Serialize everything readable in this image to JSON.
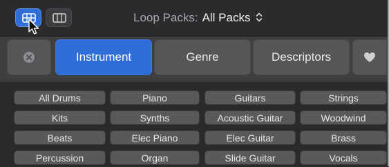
{
  "header": {
    "loop_packs_label": "Loop Packs:",
    "loop_packs_value": "All Packs"
  },
  "filters": {
    "instrument": "Instrument",
    "genre": "Genre",
    "descriptors": "Descriptors",
    "active": "Instrument"
  },
  "keywords": [
    [
      "All Drums",
      "Piano",
      "Guitars",
      "Strings"
    ],
    [
      "Kits",
      "Synths",
      "Acoustic Guitar",
      "Woodwind"
    ],
    [
      "Beats",
      "Elec Piano",
      "Elec Guitar",
      "Brass"
    ],
    [
      "Percussion",
      "Organ",
      "Slide Guitar",
      "Vocals"
    ]
  ],
  "colors": {
    "accent": "#2f6ed6",
    "button": "#565659",
    "keyword": "#59595c"
  },
  "icons": {
    "view_button_button_view": "button-view-icon",
    "view_button_column_view": "column-view-icon",
    "reset": "clear-circle-icon",
    "favorites": "heart-icon",
    "popup": "up-down-chevron-icon"
  }
}
